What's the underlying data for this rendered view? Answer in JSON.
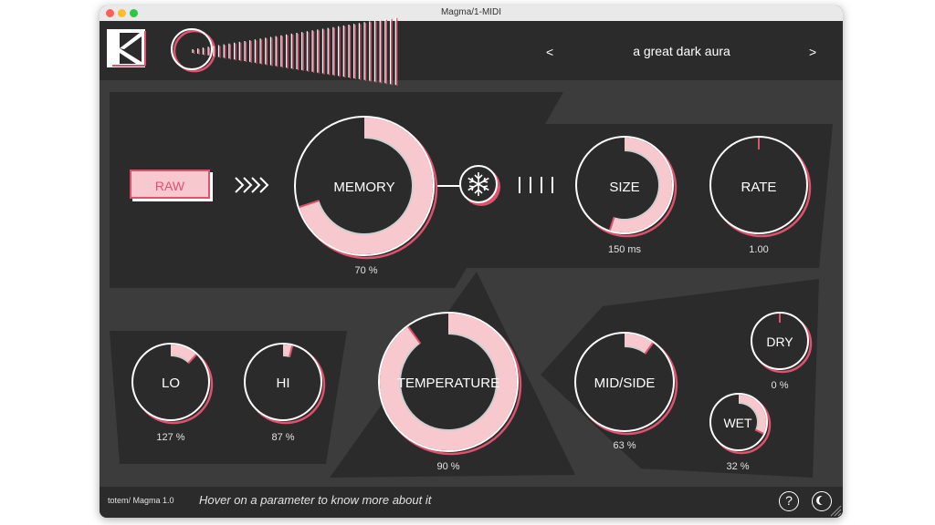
{
  "window": {
    "title": "Magma/1-MIDI"
  },
  "header": {
    "preset_name": "a great dark aura",
    "prev_label": "<",
    "next_label": ">"
  },
  "controls": {
    "raw_label": "RAW",
    "memory": {
      "label": "MEMORY",
      "value_text": "70 %",
      "value": 0.7
    },
    "size": {
      "label": "SIZE",
      "value_text": "150 ms",
      "value": 0.55
    },
    "rate": {
      "label": "RATE",
      "value_text": "1.00",
      "value": 0.0
    },
    "lo": {
      "label": "LO",
      "value_text": "127 %",
      "value": 0.12
    },
    "hi": {
      "label": "HI",
      "value_text": "87 %",
      "value": 0.04
    },
    "temperature": {
      "label": "TEMPERATURE",
      "value_text": "90 %",
      "value": 0.9
    },
    "midside": {
      "label": "MID/SIDE",
      "value_text": "63 %",
      "value": 0.1
    },
    "dry": {
      "label": "DRY",
      "value_text": "0 %",
      "value": 0.0
    },
    "wet": {
      "label": "WET",
      "value_text": "32 %",
      "value": 0.32
    }
  },
  "footer": {
    "brand": "totem/ Magma 1.0",
    "hint": "Hover on a parameter to know more about it",
    "help_label": "?"
  },
  "colors": {
    "accent": "#e0516d",
    "knob_fill": "#f7c9cf",
    "background": "#3c3c3c",
    "panel": "#2b2b2b"
  }
}
